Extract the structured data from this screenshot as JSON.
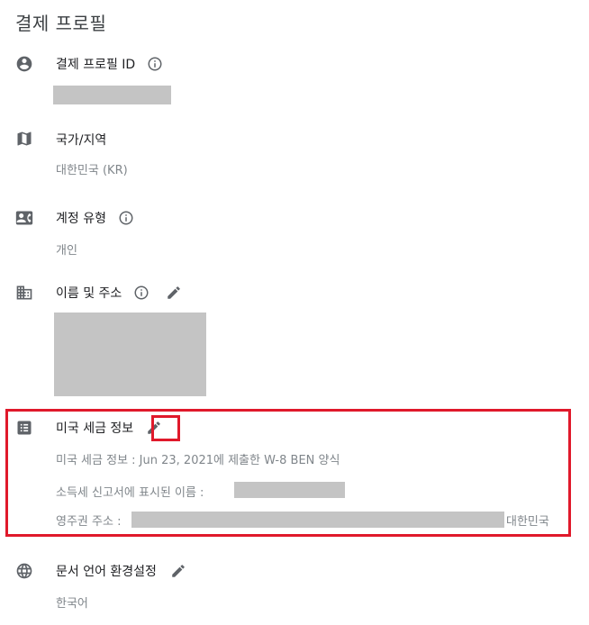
{
  "page": {
    "title": "결제 프로필"
  },
  "profile_id": {
    "label": "결제 프로필 ID"
  },
  "country": {
    "label": "국가/지역",
    "value": "대한민국 (KR)"
  },
  "account_type": {
    "label": "계정 유형",
    "value": "개인"
  },
  "name_address": {
    "label": "이름 및 주소"
  },
  "us_tax": {
    "label": "미국 세금 정보",
    "info_line": "미국 세금 정보 : Jun 23, 2021에 제출한 W-8 BEN 양식",
    "name_label": "소득세 신고서에 표시된 이름 :",
    "residence_label": "영주권 주소 :",
    "residence_country": "대한민국"
  },
  "document_language": {
    "label": "문서 언어 환경설정",
    "value": "한국어"
  },
  "icons": {
    "profile": "account-circle-icon",
    "country": "map-icon",
    "account_type": "contact-card-icon",
    "name_address": "building-icon",
    "us_tax": "list-icon",
    "language": "globe-icon",
    "info": "info-icon",
    "edit": "pencil-icon"
  },
  "colors": {
    "highlight": "#e0192b",
    "icon": "#5f6368",
    "secondary_text": "#80868b"
  }
}
